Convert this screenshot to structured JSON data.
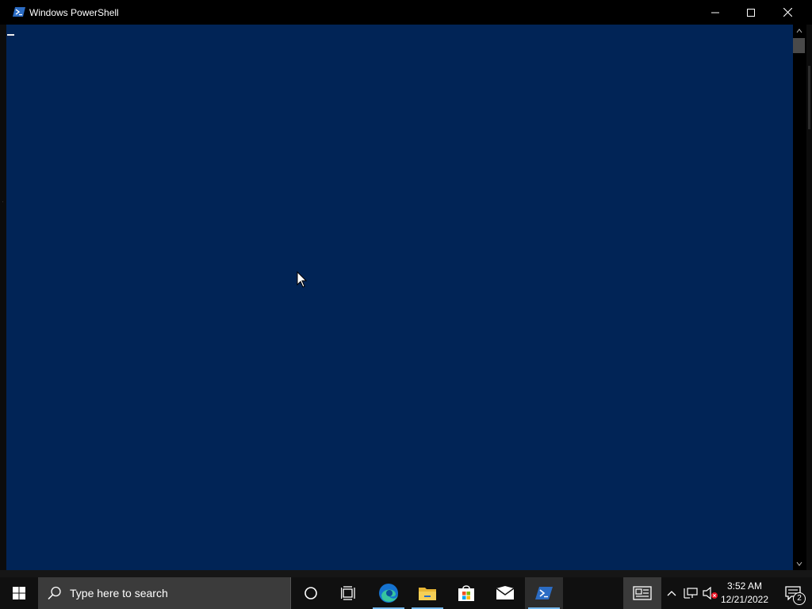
{
  "window": {
    "title": "Windows PowerShell",
    "console_background": "#012456"
  },
  "controls": {
    "minimize_icon": "minimize-icon",
    "maximize_icon": "maximize-icon",
    "close_icon": "close-icon"
  },
  "taskbar": {
    "search_placeholder": "Type here to search",
    "pinned": [
      "cortana-icon",
      "task-view-icon",
      "edge-icon",
      "file-explorer-icon",
      "store-icon",
      "mail-icon",
      "powershell-icon"
    ],
    "active_app": "powershell-icon",
    "accent": "#76b9ed"
  },
  "tray": {
    "time": "3:52 AM",
    "date": "12/21/2022",
    "notification_count": "2"
  }
}
